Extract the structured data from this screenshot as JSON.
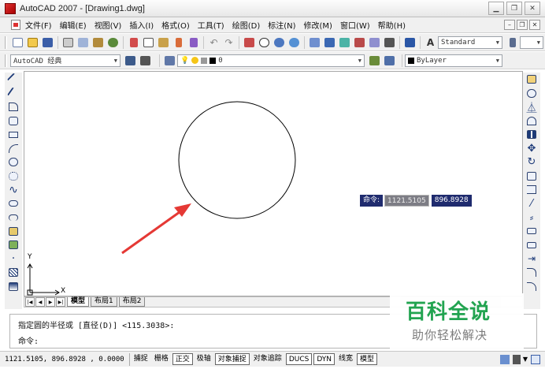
{
  "window": {
    "title": "AutoCAD 2007 - [Drawing1.dwg]"
  },
  "menu": [
    "文件(F)",
    "编辑(E)",
    "视图(V)",
    "插入(I)",
    "格式(O)",
    "工具(T)",
    "绘图(D)",
    "标注(N)",
    "修改(M)",
    "窗口(W)",
    "帮助(H)"
  ],
  "toolbar": {
    "text_style": "Standard",
    "workspace": "AutoCAD 经典",
    "layer": "0",
    "color": "ByLayer"
  },
  "tabs": [
    "模型",
    "布局1",
    "布局2"
  ],
  "command": {
    "line1": "指定圆的半径或 [直径(D)] <115.3038>:",
    "line2": "命令:"
  },
  "dynamic_input": {
    "label": "命令:",
    "x_value": "1121.5105",
    "y_value": "896.8928"
  },
  "ucs": {
    "y": "Y",
    "x": "X"
  },
  "status": {
    "coords": "1121.5105,  896.8928 , 0.0000",
    "buttons": [
      "捕捉",
      "栅格",
      "正交",
      "极轴",
      "对象捕捉",
      "对象追踪",
      "DUCS",
      "DYN",
      "线宽",
      "模型"
    ],
    "on_buttons": [
      "正交",
      "对象捕捉",
      "DUCS",
      "DYN",
      "模型"
    ]
  },
  "watermark": {
    "title": "百科全说",
    "subtitle": "助你轻松解决"
  },
  "colors": {
    "arrow": "#e53935",
    "dyn_bg": "#1f2b6e",
    "watermark": "#1aa14a"
  }
}
